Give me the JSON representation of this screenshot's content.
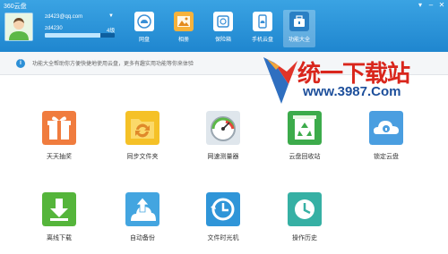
{
  "app": {
    "title": "360云盘",
    "window_controls": [
      "▾",
      "–",
      "✕"
    ]
  },
  "user": {
    "email": "zd423@qq.com",
    "id": "zd4230",
    "level": "4级",
    "quota_fraction": 0.8
  },
  "nav": [
    {
      "label": "网盘"
    },
    {
      "label": "相册"
    },
    {
      "label": "保险箱"
    },
    {
      "label": "手机云盘"
    },
    {
      "label": "功能大全",
      "active": true
    }
  ],
  "info": {
    "text": "功能大全帮助你方便快捷地使用云盘，更多有趣实用功能等你来体验"
  },
  "watermark": {
    "line1": "统一下载站",
    "line2": "www.3987.Com"
  },
  "tiles": [
    {
      "label": "天天抽奖",
      "icon": "gift-icon",
      "color": "#f07c3e"
    },
    {
      "label": "同步文件夹",
      "icon": "sync-folder-icon",
      "color": "#f5c127"
    },
    {
      "label": "网速测量器",
      "icon": "speedometer-icon",
      "color": "#e8eef3"
    },
    {
      "label": "云盘回收站",
      "icon": "recycle-icon",
      "color": "#3cab4b"
    },
    {
      "label": "锁定云盘",
      "icon": "lock-cloud-icon",
      "color": "#4a9ee0"
    },
    {
      "label": "离线下载",
      "icon": "download-icon",
      "color": "#55b53b"
    },
    {
      "label": "自动备份",
      "icon": "backup-icon",
      "color": "#43a5e0"
    },
    {
      "label": "文件时光机",
      "icon": "time-machine-icon",
      "color": "#2f95d8"
    },
    {
      "label": "操作历史",
      "icon": "history-icon",
      "color": "#36b0a4"
    }
  ],
  "colors": {
    "header": "#1f86cf",
    "info_icon": "#2c8fd6",
    "watermark_red": "#d9261c",
    "watermark_blue": "#1d4f9b"
  }
}
